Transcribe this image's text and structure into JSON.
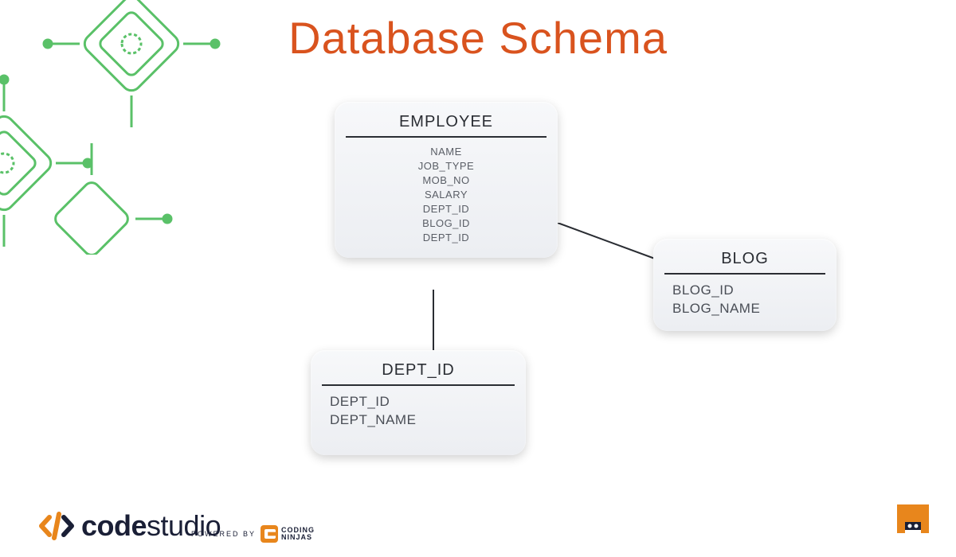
{
  "title": "Database Schema",
  "entities": {
    "employee": {
      "name": "EMPLOYEE",
      "fields": [
        "NAME",
        "JOB_TYPE",
        "MOB_NO",
        "SALARY",
        "DEPT_ID",
        "BLOG_ID",
        "DEPT_ID"
      ]
    },
    "blog": {
      "name": "BLOG",
      "fields": [
        "BLOG_ID",
        "BLOG_NAME"
      ]
    },
    "dept": {
      "name": "DEPT_ID",
      "fields": [
        "DEPT_ID",
        "DEPT_NAME"
      ]
    }
  },
  "branding": {
    "codestudio_bold": "code",
    "codestudio_light": "studio",
    "powered_by": "POWERED BY",
    "cn_line1": "CODING",
    "cn_line2": "NINJAS"
  },
  "colors": {
    "title": "#d9531e",
    "circuit": "#3eb74e",
    "logo_orange": "#e8861c",
    "logo_dark": "#1a1f36"
  }
}
